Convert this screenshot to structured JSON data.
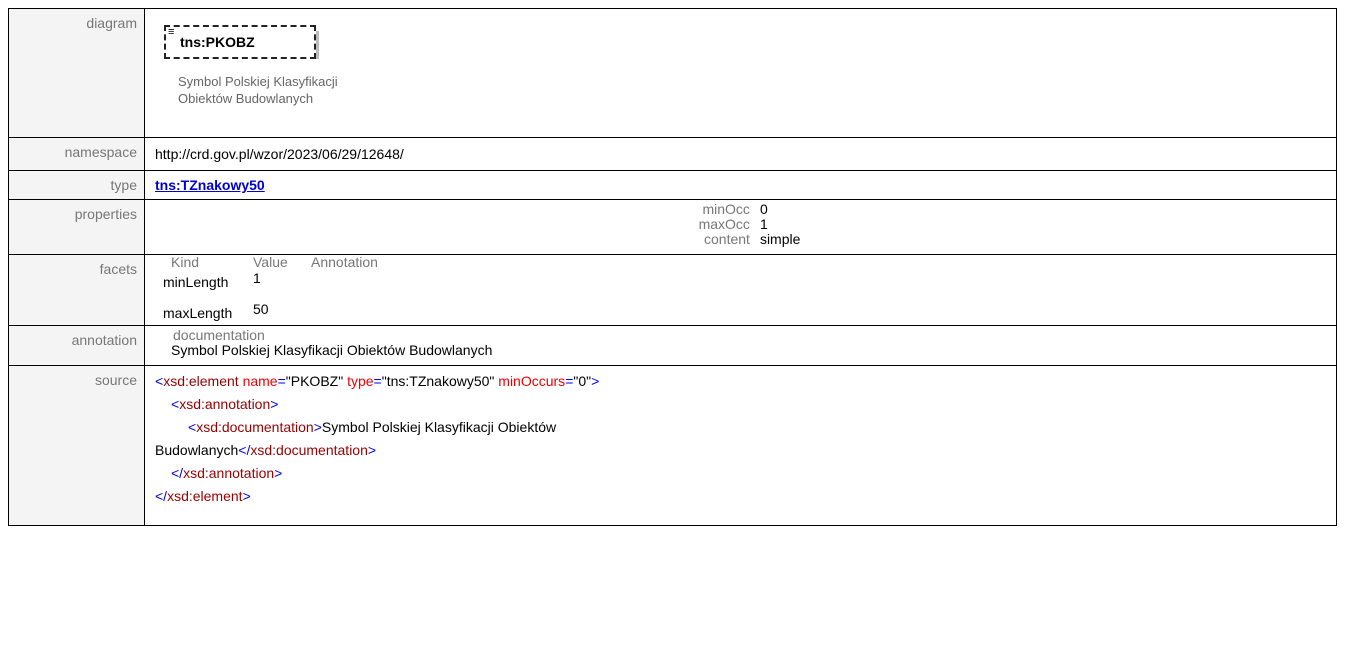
{
  "rows": {
    "diagram": {
      "label": "diagram"
    },
    "namespace": {
      "label": "namespace",
      "value": "http://crd.gov.pl/wzor/2023/06/29/12648/"
    },
    "type": {
      "label": "type",
      "value": "tns:TZnakowy50"
    },
    "properties": {
      "label": "properties",
      "items": [
        {
          "key": "minOcc",
          "value": "0"
        },
        {
          "key": "maxOcc",
          "value": "1"
        },
        {
          "key": "content",
          "value": "simple"
        }
      ]
    },
    "facets": {
      "label": "facets",
      "headers": [
        "Kind",
        "Value",
        "Annotation"
      ],
      "items": [
        {
          "kind": "minLength",
          "value": "1"
        },
        {
          "kind": "maxLength",
          "value": "50"
        }
      ]
    },
    "annotation": {
      "label": "annotation",
      "doc_label": "documentation",
      "doc_text": "Symbol Polskiej Klasyfikacji Obiektów Budowlanych"
    },
    "source": {
      "label": "source"
    }
  },
  "diagram": {
    "element_name": "tns:PKOBZ",
    "doc_line1": "Symbol Polskiej Klasyfikacji",
    "doc_line2": "Obiektów Budowlanych"
  },
  "source": {
    "line1": {
      "open": "<",
      "tag": "xsd:element",
      "a1": "name",
      "v1": "\"PKOBZ\"",
      "a2": "type",
      "v2": "\"tns:TZnakowy50\"",
      "a3": "minOccurs",
      "v3": "\"0\"",
      "close": ">"
    },
    "line2": {
      "open": "<",
      "tag": "xsd:annotation",
      "close": ">"
    },
    "line3": {
      "open": "<",
      "tag": "xsd:documentation",
      "close": ">",
      "text": "Symbol Polskiej Klasyfikacji Obiektów"
    },
    "line4": {
      "text": "Budowlanych",
      "open": "</",
      "tag": "xsd:documentation",
      "close": ">"
    },
    "line5": {
      "open": "</",
      "tag": "xsd:annotation",
      "close": ">"
    },
    "line6": {
      "open": "</",
      "tag": "xsd:element",
      "close": ">"
    }
  }
}
